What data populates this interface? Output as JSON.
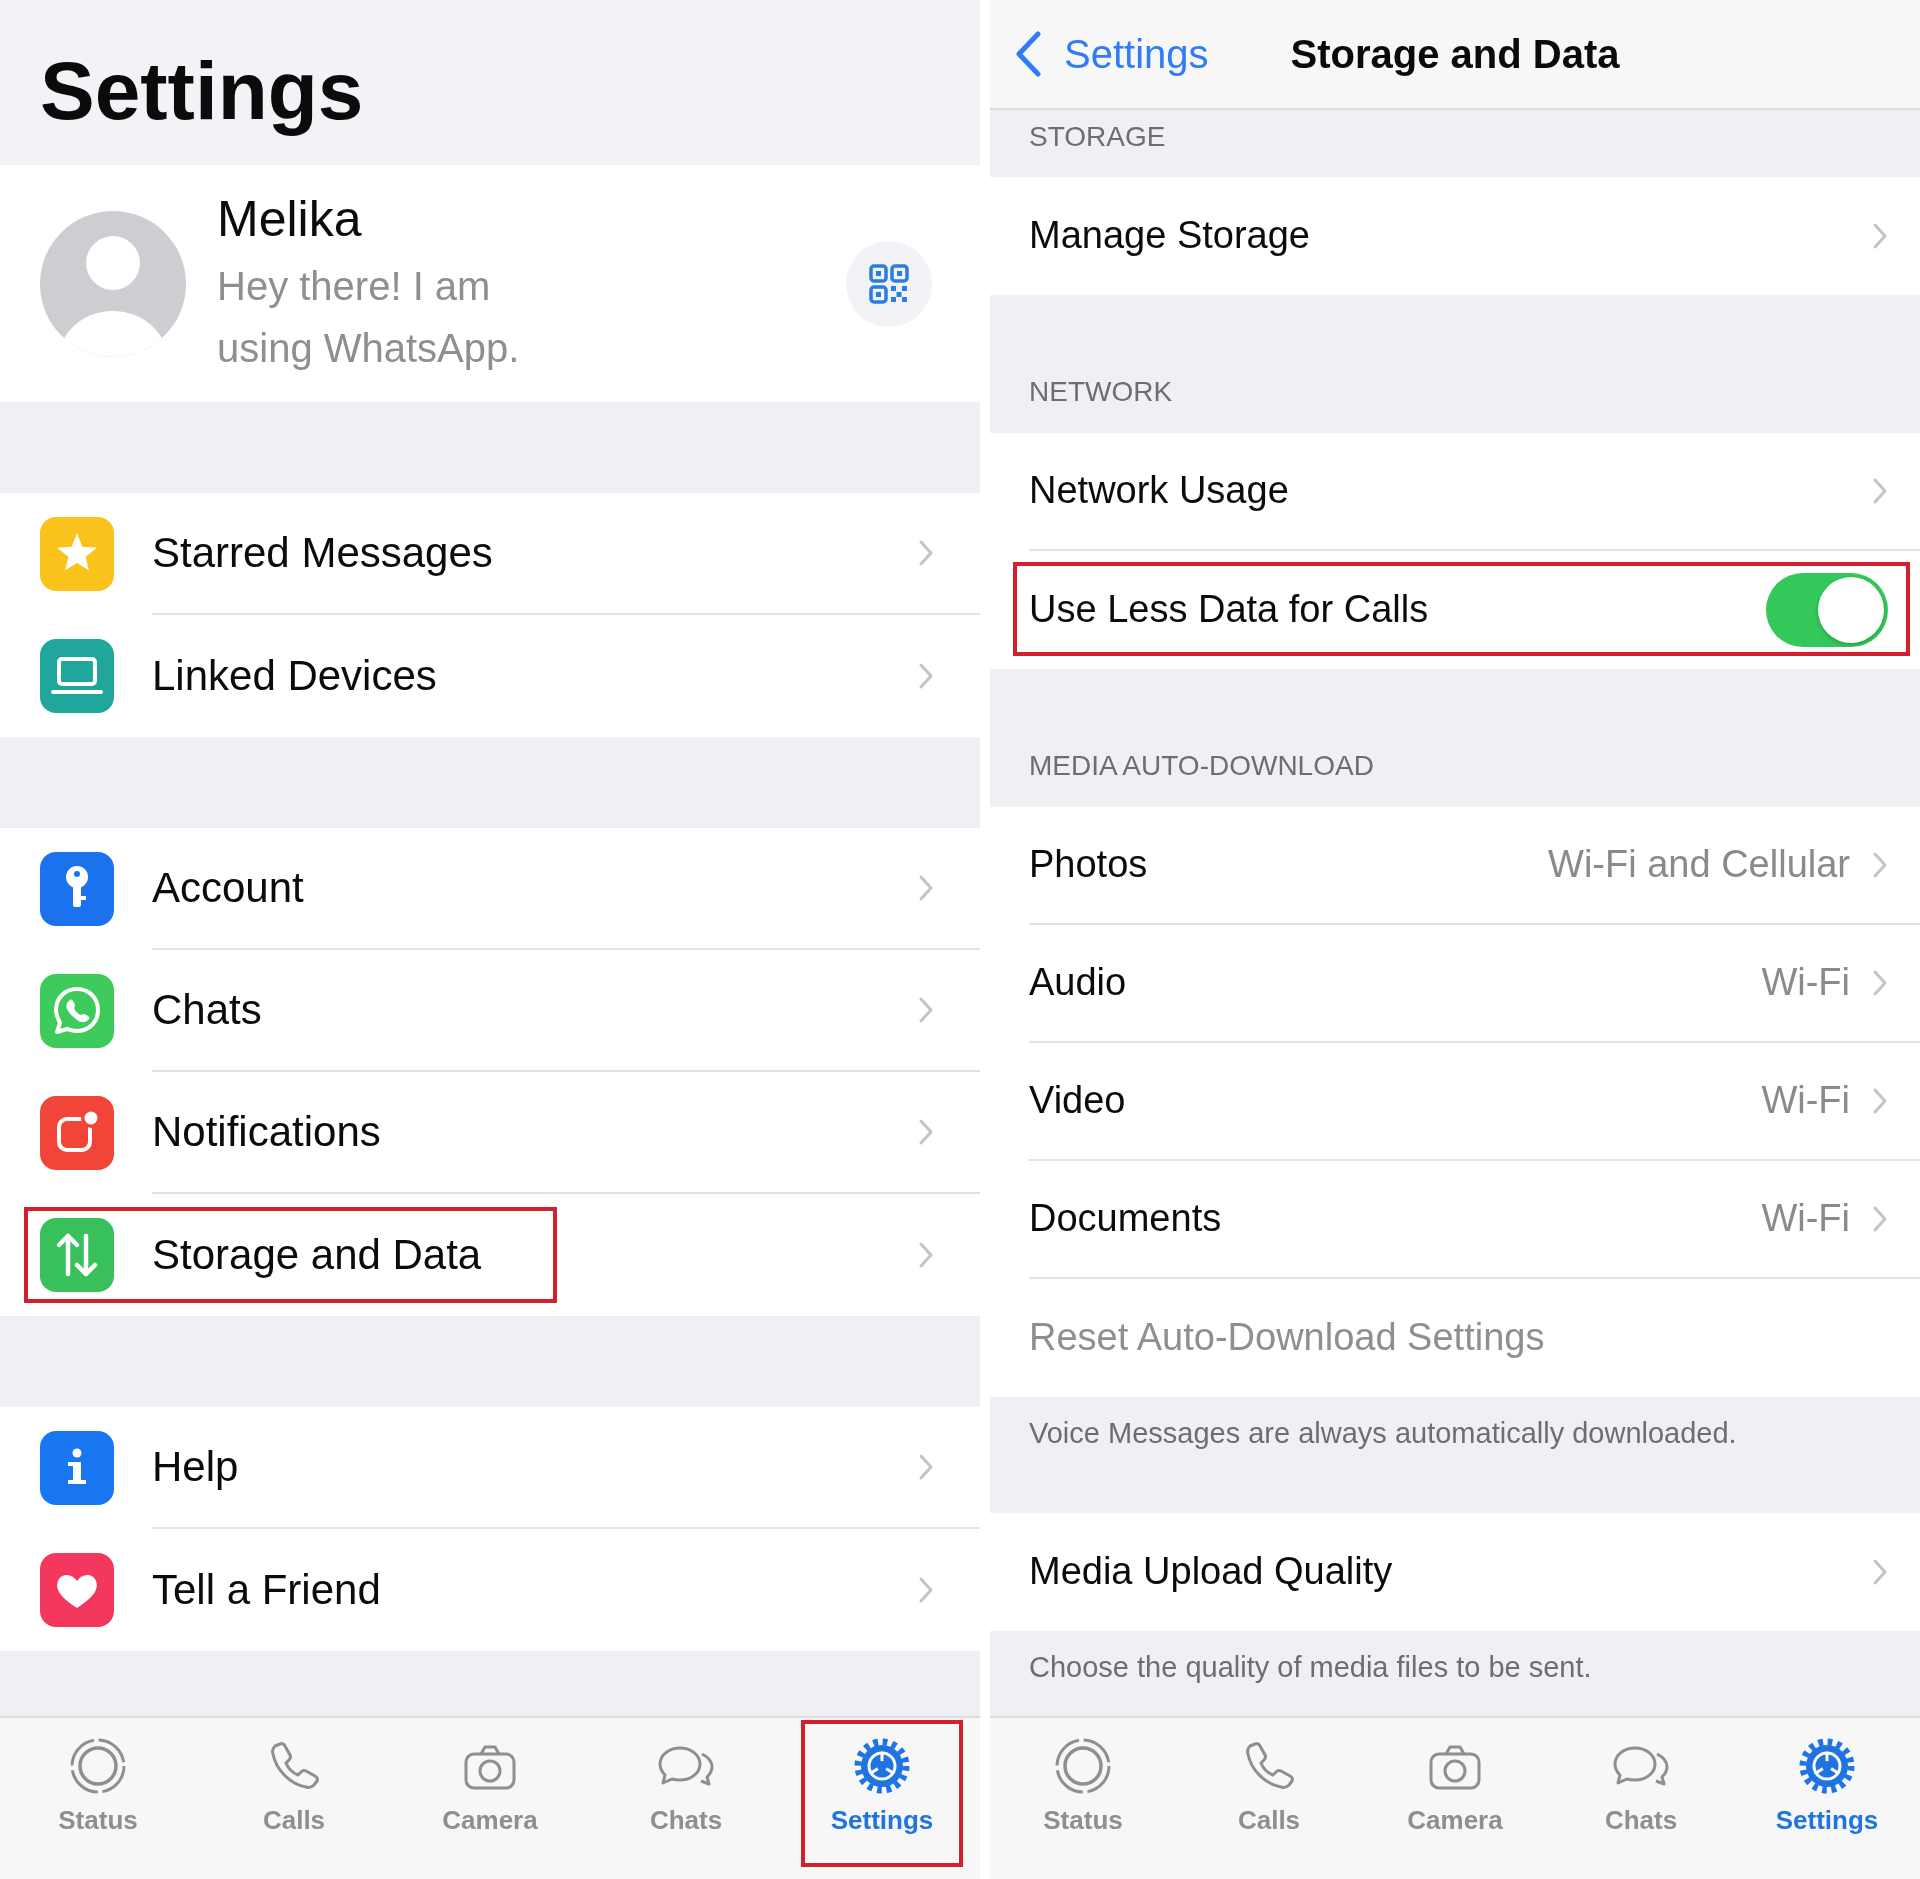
{
  "settings_screen": {
    "title": "Settings",
    "profile": {
      "name": "Melika",
      "status": "Hey there! I am using WhatsApp."
    },
    "groups": [
      {
        "items": [
          {
            "label": "Starred Messages",
            "color": "#f9c31b",
            "highlighted": false
          },
          {
            "label": "Linked Devices",
            "color": "#20a69b",
            "highlighted": false
          }
        ]
      },
      {
        "items": [
          {
            "label": "Account",
            "color": "#1c72ec",
            "highlighted": false
          },
          {
            "label": "Chats",
            "color": "#3ecb5b",
            "highlighted": false
          },
          {
            "label": "Notifications",
            "color": "#f1453a",
            "highlighted": false
          },
          {
            "label": "Storage and Data",
            "color": "#38c15a",
            "highlighted": true
          }
        ]
      },
      {
        "items": [
          {
            "label": "Help",
            "color": "#1877f0",
            "highlighted": false
          },
          {
            "label": "Tell a Friend",
            "color": "#f3375d",
            "highlighted": false
          }
        ]
      }
    ],
    "tab_bar": [
      {
        "label": "Status",
        "selected": false,
        "highlighted": false
      },
      {
        "label": "Calls",
        "selected": false,
        "highlighted": false
      },
      {
        "label": "Camera",
        "selected": false,
        "highlighted": false
      },
      {
        "label": "Chats",
        "selected": false,
        "highlighted": false
      },
      {
        "label": "Settings",
        "selected": true,
        "highlighted": true
      }
    ]
  },
  "storage_screen": {
    "back_label": "Settings",
    "title": "Storage and Data",
    "sections": [
      {
        "header": "STORAGE",
        "rows": [
          {
            "kind": "link",
            "label": "Manage Storage",
            "highlighted": false
          }
        ]
      },
      {
        "header": "NETWORK",
        "rows": [
          {
            "kind": "link",
            "label": "Network Usage",
            "highlighted": false
          },
          {
            "kind": "toggle",
            "label": "Use Less Data for Calls",
            "on": true,
            "highlighted": true
          }
        ]
      },
      {
        "header": "MEDIA AUTO-DOWNLOAD",
        "rows": [
          {
            "kind": "link",
            "label": "Photos",
            "value": "Wi-Fi and Cellular",
            "highlighted": false
          },
          {
            "kind": "link",
            "label": "Audio",
            "value": "Wi-Fi",
            "highlighted": false
          },
          {
            "kind": "link",
            "label": "Video",
            "value": "Wi-Fi",
            "highlighted": false
          },
          {
            "kind": "link",
            "label": "Documents",
            "value": "Wi-Fi",
            "highlighted": false
          },
          {
            "kind": "action",
            "label": "Reset Auto-Download Settings",
            "disabled": true,
            "highlighted": false
          }
        ],
        "footer": "Voice Messages are always automatically downloaded."
      },
      {
        "rows": [
          {
            "kind": "link",
            "label": "Media Upload Quality",
            "highlighted": false
          }
        ],
        "footer": "Choose the quality of media files to be sent."
      }
    ],
    "tab_bar": [
      {
        "label": "Status",
        "selected": false,
        "highlighted": false
      },
      {
        "label": "Calls",
        "selected": false,
        "highlighted": false
      },
      {
        "label": "Camera",
        "selected": false,
        "highlighted": false
      },
      {
        "label": "Chats",
        "selected": false,
        "highlighted": false
      },
      {
        "label": "Settings",
        "selected": true,
        "highlighted": false
      }
    ]
  }
}
